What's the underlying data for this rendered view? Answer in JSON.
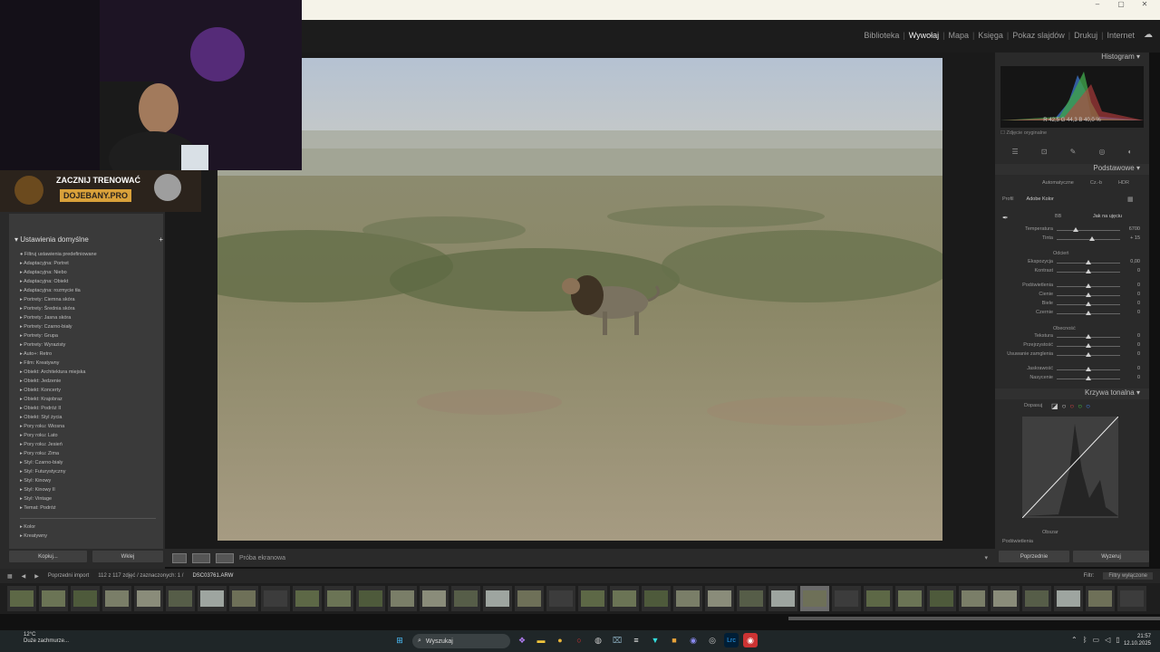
{
  "window": {
    "controls": [
      "–",
      "▢",
      "✕"
    ]
  },
  "modules": [
    {
      "label": "Biblioteka",
      "active": false
    },
    {
      "label": "Wywołaj",
      "active": true
    },
    {
      "label": "Mapa",
      "active": false
    },
    {
      "label": "Księga",
      "active": false
    },
    {
      "label": "Pokaz slajdów",
      "active": false
    },
    {
      "label": "Drukuj",
      "active": false
    },
    {
      "label": "Internet",
      "active": false
    }
  ],
  "stream_overlay": {
    "promo_line1": "ZACZNIJ TRENOWAĆ",
    "promo_line2": "DOJEBANY.PRO"
  },
  "left_panel": {
    "header": "Ustawienia domyślne",
    "filter_label": "Filtruj ustawienia predefiniowane",
    "presets": [
      "Adaptacyjna: Portret",
      "Adaptacyjna: Niebo",
      "Adaptacyjna: Obiekt",
      "Adaptacyjna: rozmycie tła",
      "Portrety: Ciemna skóra",
      "Portrety: Średnia skóra",
      "Portrety: Jasna skóra",
      "Portrety: Czarno-biały",
      "Portrety: Grupa",
      "Portrety: Wyrazisty",
      "Auto+: Retro",
      "Film: Kreatywny",
      "Obiekt: Architektura miejska",
      "Obiekt: Jedzenie",
      "Obiekt: Koncerty",
      "Obiekt: Krajobraz",
      "Obiekt: Podróż II",
      "Obiekt: Styl życia",
      "Pory roku: Wiosna",
      "Pory roku: Lato",
      "Pory roku: Jesień",
      "Pory roku: Zima",
      "Styl: Czarno-biały",
      "Styl: Futurystyczny",
      "Styl: Kinowy",
      "Styl: Kinowy II",
      "Styl: Vintage",
      "Temat: Podróż"
    ],
    "presets_extra": [
      "Kolor",
      "Kreatywny"
    ],
    "copy_button": "Kopiuj...",
    "paste_button": "Wklej"
  },
  "toolbar": {
    "soft_proof": "Próba ekranowa"
  },
  "right_panel": {
    "histogram_title": "Histogram",
    "hist_r": "R 42,5",
    "hist_g": "G 44,3",
    "hist_b": "B 40,0 %",
    "original_photo": "Zdjęcie oryginalne",
    "basic_title": "Podstawowe",
    "treatment": [
      "Automatyczne",
      "Cz.-b",
      "HDR"
    ],
    "profile_label": "Profil",
    "profile_value": "Adobe Kolor",
    "wb_label": "BB",
    "wb_value": "Jak na ujęciu",
    "tone_label": "Odcień",
    "presence_label": "Obecność",
    "sliders": [
      {
        "label": "Temperatura",
        "value": "6700",
        "pos": 0.3
      },
      {
        "label": "Tinta",
        "value": "+ 15",
        "pos": 0.55
      },
      {
        "label": "Ekspozycja",
        "value": "0,00",
        "pos": 0.5
      },
      {
        "label": "Kontrast",
        "value": "0",
        "pos": 0.5
      },
      {
        "label": "Podświetlenia",
        "value": "0",
        "pos": 0.5
      },
      {
        "label": "Cienie",
        "value": "0",
        "pos": 0.5
      },
      {
        "label": "Biele",
        "value": "0",
        "pos": 0.5
      },
      {
        "label": "Czernie",
        "value": "0",
        "pos": 0.5
      },
      {
        "label": "Tekstura",
        "value": "0",
        "pos": 0.5
      },
      {
        "label": "Przejrzystość",
        "value": "0",
        "pos": 0.5
      },
      {
        "label": "Usuwanie zamglenia",
        "value": "0",
        "pos": 0.5
      },
      {
        "label": "Jaskrawość",
        "value": "0",
        "pos": 0.5
      },
      {
        "label": "Nasycenie",
        "value": "0",
        "pos": 0.5
      }
    ],
    "curve_title": "Krzywa tonalna",
    "curve_adjust": "Dopasuj",
    "region_label": "Obszar",
    "highlights_label": "Podświetlenia",
    "previous_button": "Poprzednie",
    "reset_button": "Wyzeruj"
  },
  "filmstrip": {
    "source": "Poprzedni import",
    "count": "112 z 117 zdjęć / zaznaczonych: 1 /",
    "filename": "DSC03761.ARW",
    "filter_label": "Filtr:",
    "filter_value": "Filtry wyłączone"
  },
  "taskbar": {
    "temp": "12°C",
    "weather": "Duże zachmurze...",
    "search": "Wyszukaj",
    "time": "21:57",
    "date": "12.10.2025"
  }
}
